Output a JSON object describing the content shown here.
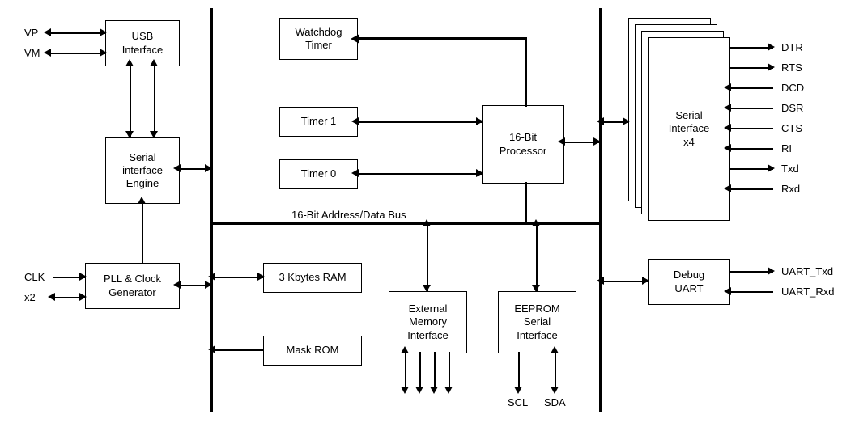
{
  "bus_label": "16-Bit Address/Data Bus",
  "blocks": {
    "usb_if": "USB\nInterface",
    "sie": "Serial\ninterface\nEngine",
    "pll": "PLL & Clock\nGenerator",
    "wdt": "Watchdog\nTimer",
    "timer1": "Timer 1",
    "timer0": "Timer 0",
    "cpu": "16-Bit\nProcessor",
    "ram": "3 Kbytes RAM",
    "rom": "Mask ROM",
    "ext_mem": "External\nMemory\nInterface",
    "eeprom": "EEPROM\nSerial\nInterface",
    "serial_x4": "Serial\nInterface\nx4",
    "debug_uart": "Debug\nUART"
  },
  "left_signals": {
    "vp": "VP",
    "vm": "VM",
    "clk": "CLK",
    "x2": "x2"
  },
  "right_signals": {
    "dtr": "DTR",
    "rts": "RTS",
    "dcd": "DCD",
    "dsr": "DSR",
    "cts": "CTS",
    "ri": "RI",
    "txd": "Txd",
    "rxd": "Rxd",
    "uart_txd": "UART_Txd",
    "uart_rxd": "UART_Rxd"
  },
  "bottom_signals": {
    "scl": "SCL",
    "sda": "SDA"
  }
}
